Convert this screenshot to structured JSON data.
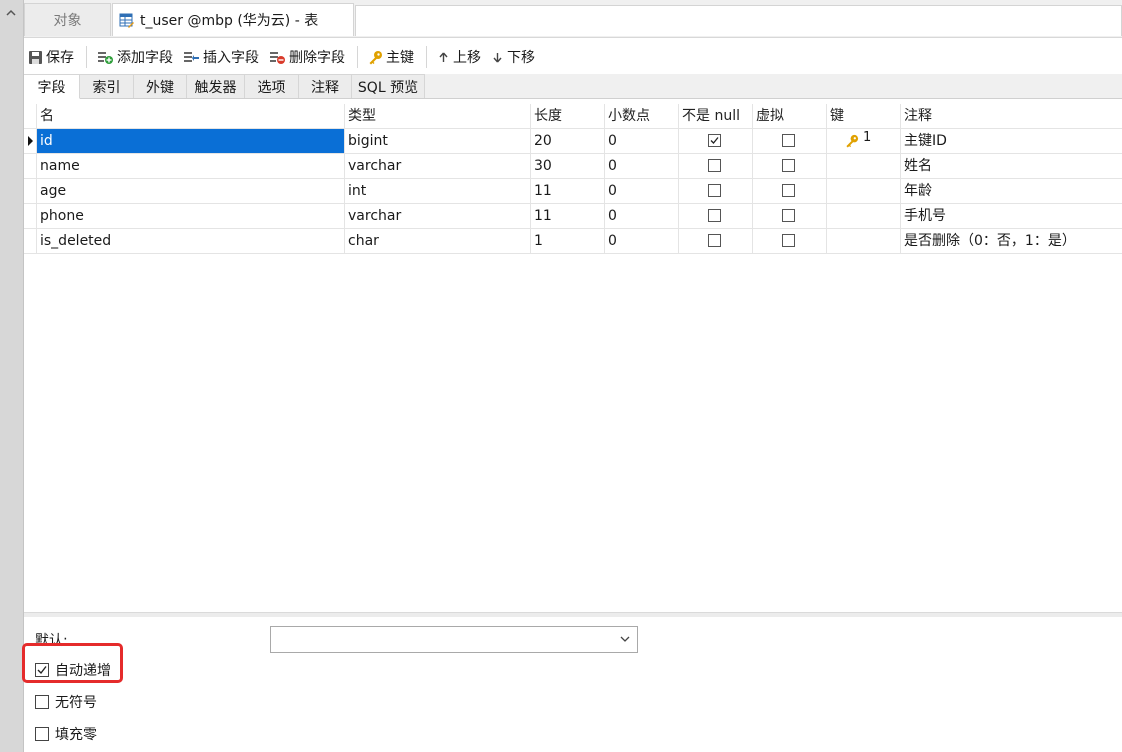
{
  "tabs": {
    "objects_label": "对象",
    "table_tab_label": "t_user @mbp (华为云) - 表"
  },
  "toolbar": {
    "save": "保存",
    "add_field": "添加字段",
    "insert_field": "插入字段",
    "delete_field": "删除字段",
    "primary_key": "主键",
    "move_up": "上移",
    "move_down": "下移"
  },
  "subtabs": [
    "字段",
    "索引",
    "外键",
    "触发器",
    "选项",
    "注释",
    "SQL 预览"
  ],
  "grid": {
    "headers": {
      "name": "名",
      "type": "类型",
      "length": "长度",
      "decimals": "小数点",
      "not_null": "不是 null",
      "virtual": "虚拟",
      "key": "键",
      "comment": "注释"
    },
    "rows": [
      {
        "name": "id",
        "type": "bigint",
        "length": "20",
        "decimals": "0",
        "not_null": true,
        "virtual": false,
        "key": "1",
        "comment": "主键ID"
      },
      {
        "name": "name",
        "type": "varchar",
        "length": "30",
        "decimals": "0",
        "not_null": false,
        "virtual": false,
        "key": "",
        "comment": "姓名"
      },
      {
        "name": "age",
        "type": "int",
        "length": "11",
        "decimals": "0",
        "not_null": false,
        "virtual": false,
        "key": "",
        "comment": "年龄"
      },
      {
        "name": "phone",
        "type": "varchar",
        "length": "11",
        "decimals": "0",
        "not_null": false,
        "virtual": false,
        "key": "",
        "comment": "手机号"
      },
      {
        "name": "is_deleted",
        "type": "char",
        "length": "1",
        "decimals": "0",
        "not_null": false,
        "virtual": false,
        "key": "",
        "comment": "是否删除（0：否，1：是）"
      }
    ]
  },
  "properties": {
    "default_label": "默认:",
    "default_value": "",
    "auto_increment_label": "自动递增",
    "auto_increment_checked": true,
    "unsigned_label": "无符号",
    "unsigned_checked": false,
    "zerofill_label": "填充零",
    "zerofill_checked": false
  },
  "colors": {
    "selection": "#0a6fd6",
    "highlight_box": "#e52b2b",
    "key_icon": "#e0a100"
  }
}
